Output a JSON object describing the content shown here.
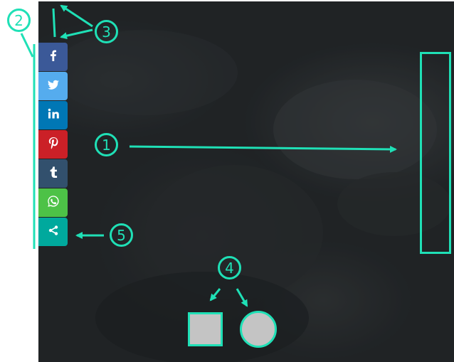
{
  "annotations": {
    "badge_1": "1",
    "badge_2": "2",
    "badge_3": "3",
    "badge_4": "4",
    "badge_5": "5",
    "color": "#1fe0b6"
  },
  "share_bar": {
    "buttons": [
      {
        "name": "facebook",
        "icon": "facebook-icon",
        "color": "#3b5998"
      },
      {
        "name": "twitter",
        "icon": "twitter-icon",
        "color": "#55acee"
      },
      {
        "name": "linkedin",
        "icon": "linkedin-icon",
        "color": "#0077b5"
      },
      {
        "name": "pinterest",
        "icon": "pinterest-icon",
        "color": "#cb2027"
      },
      {
        "name": "tumblr",
        "icon": "tumblr-icon",
        "color": "#32506d"
      },
      {
        "name": "whatsapp",
        "icon": "whatsapp-icon",
        "color": "#4dc247"
      },
      {
        "name": "share",
        "icon": "share-icon",
        "color": "#00a99d"
      }
    ]
  },
  "toggles": {
    "square_color": "#c4c4c4",
    "circle_color": "#c4c4c4"
  }
}
